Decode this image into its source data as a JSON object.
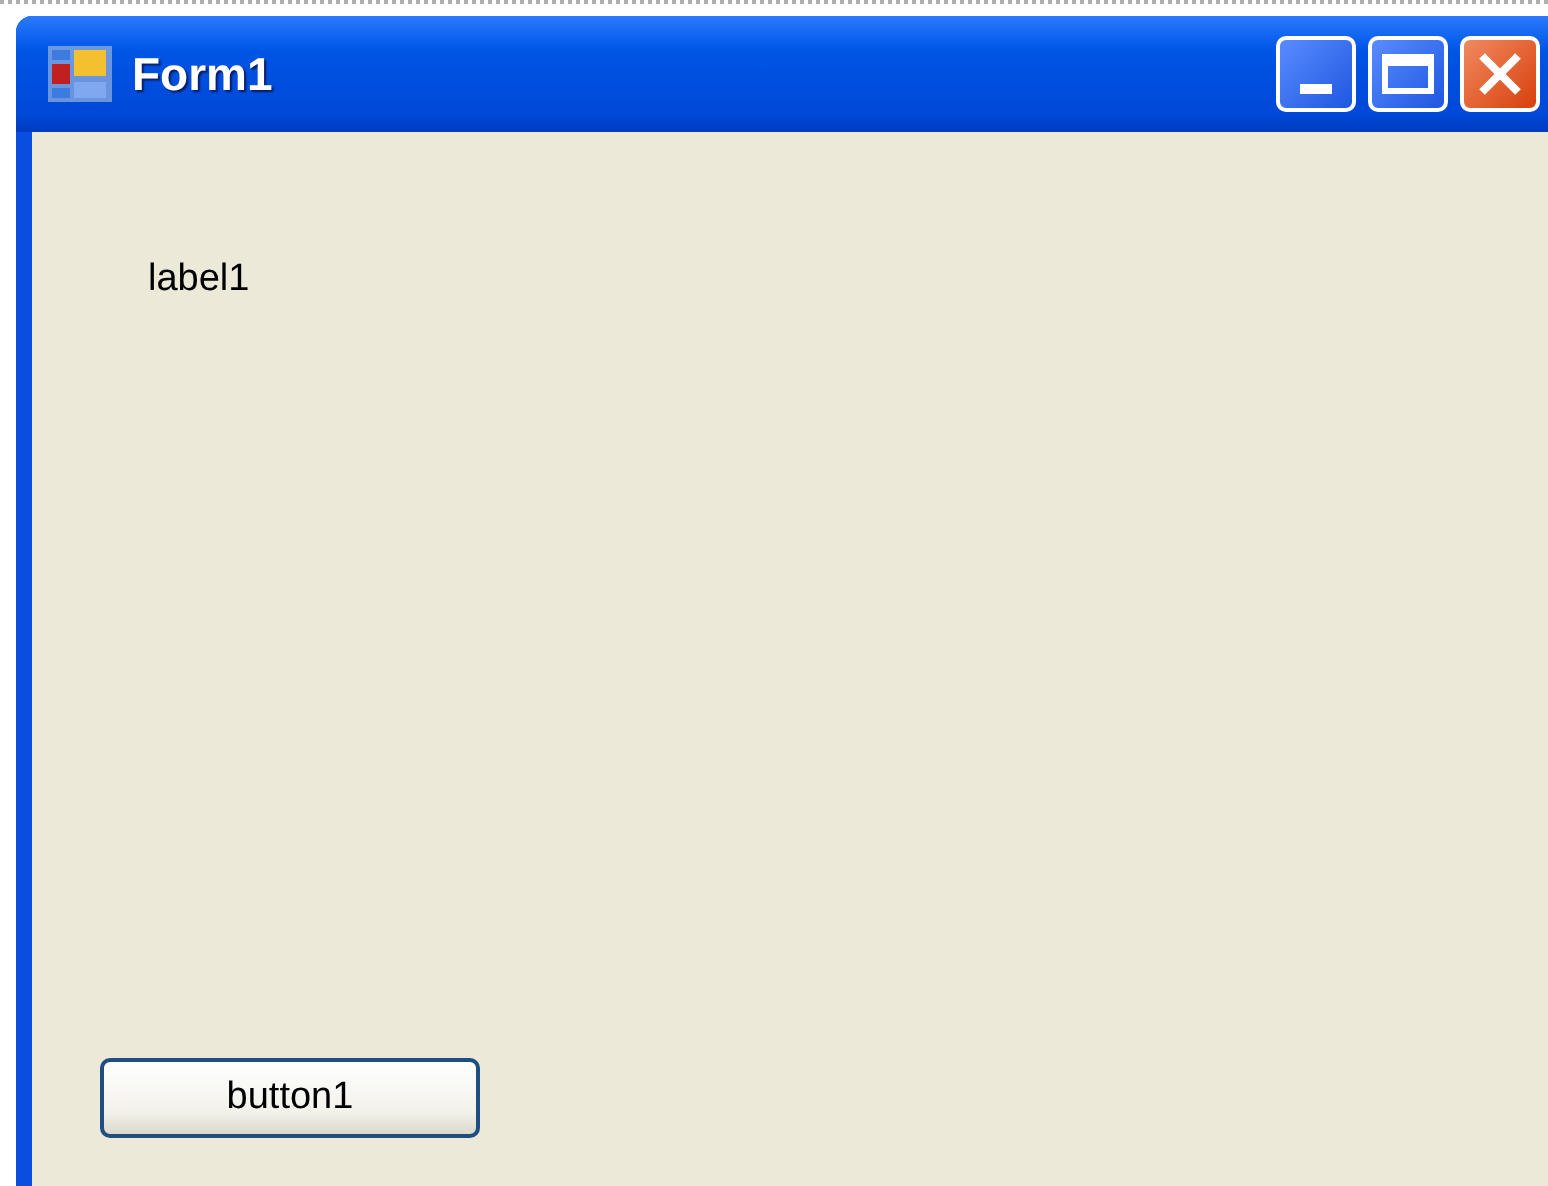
{
  "window": {
    "title": "Form1"
  },
  "label": "label1",
  "button": "button1"
}
